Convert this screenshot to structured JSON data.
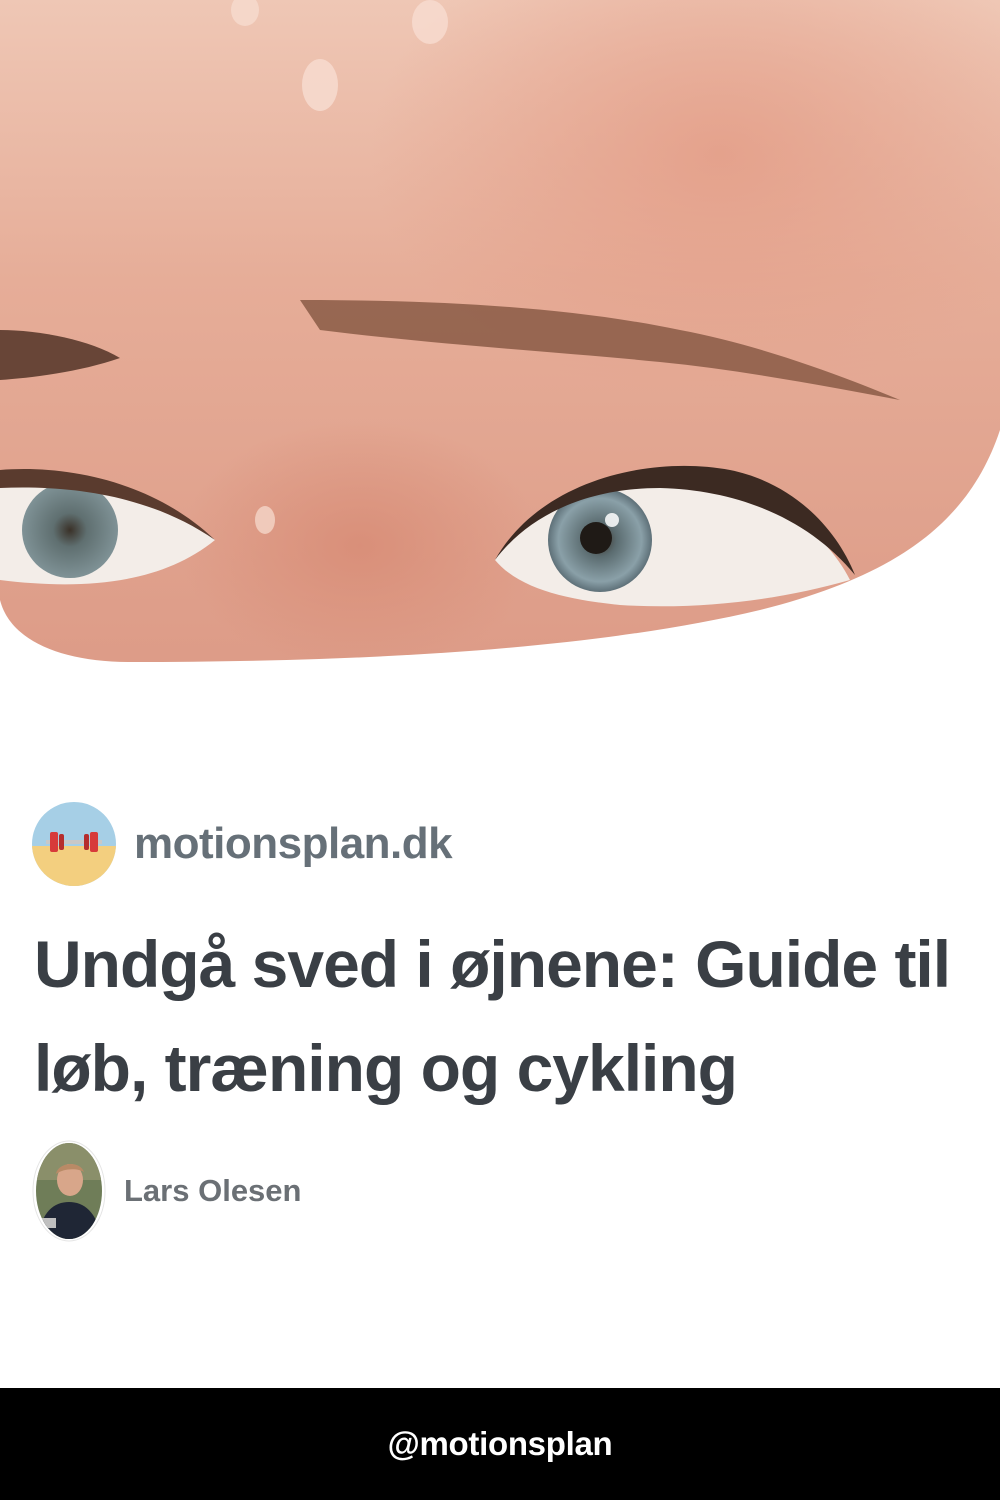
{
  "hero": {
    "image": "sweaty-forehead-eyes-photo"
  },
  "site": {
    "logo_icon": "barbell-icon",
    "name": "motionsplan.dk"
  },
  "article": {
    "title": "Undgå sved i øjnene: Guide til løb, træning og cykling"
  },
  "author": {
    "avatar_icon": "author-photo",
    "name": "Lars Olesen"
  },
  "footer": {
    "handle": "@motionsplan"
  },
  "colors": {
    "title": "#3a3f45",
    "site_name": "#667078",
    "author_name": "#6b7075",
    "footer_bg": "#000000",
    "footer_text": "#ffffff"
  }
}
